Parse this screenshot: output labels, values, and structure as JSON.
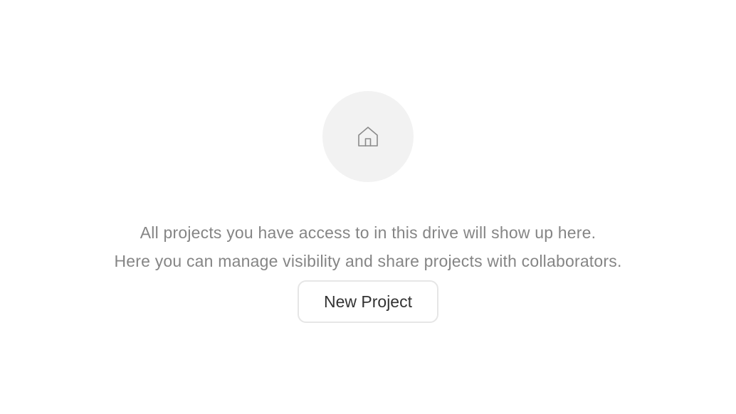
{
  "empty_state": {
    "icon": "home-icon",
    "message_line_1": "All projects you have access to in this drive will show up here.",
    "message_line_2": "Here you can manage visibility and share projects with collaborators.",
    "button_label": "New Project"
  },
  "colors": {
    "icon_circle_bg": "#f2f2f2",
    "icon_stroke": "#8a8a8a",
    "message_text": "#858585",
    "button_border": "#e6e6e6",
    "button_text": "#333333"
  }
}
